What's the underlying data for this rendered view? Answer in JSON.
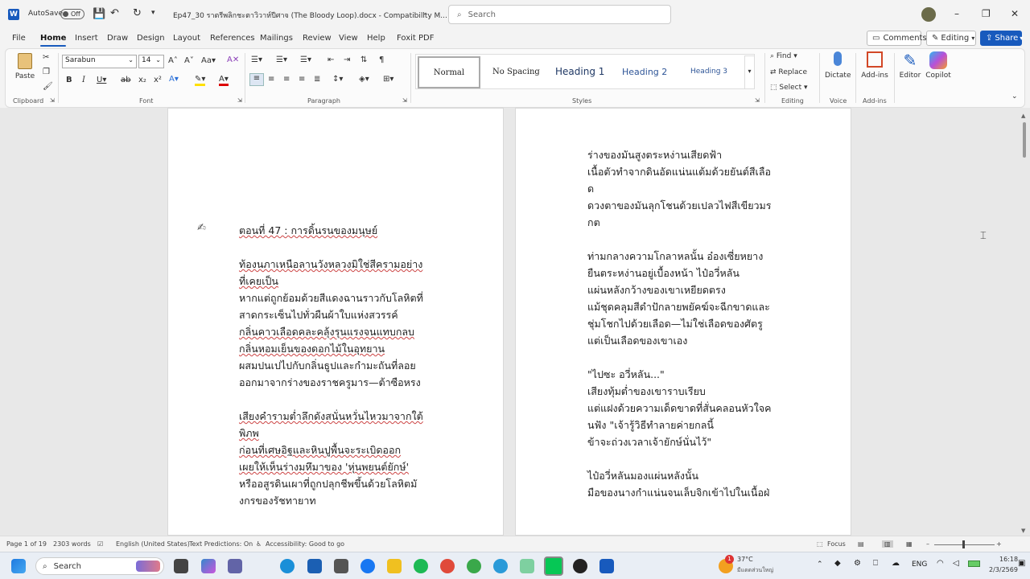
{
  "titlebar": {
    "autosave": "AutoSave",
    "autosave_state": "Off",
    "doc_title": "Ep47_30 ราตรีพลิกชะตาวิวาห์ปีศาจ (The Bloody Loop).docx  -  Compatibility M...",
    "search_placeholder": "Search"
  },
  "menu": {
    "items": [
      "File",
      "Home",
      "Insert",
      "Draw",
      "Design",
      "Layout",
      "References",
      "Mailings",
      "Review",
      "View",
      "Help",
      "Foxit PDF"
    ],
    "comments": "Comments",
    "editing": "Editing",
    "share": "Share"
  },
  "ribbon": {
    "paste": "Paste",
    "clipboard": "Clipboard",
    "font_name": "Sarabun",
    "font_size": "14",
    "font_label": "Font",
    "paragraph_label": "Paragraph",
    "styles_label": "Styles",
    "styles": [
      "Normal",
      "No Spacing",
      "Heading 1",
      "Heading 2",
      "Heading 3"
    ],
    "find": "Find",
    "replace": "Replace",
    "select": "Select",
    "editing_label": "Editing",
    "dictate": "Dictate",
    "voice_label": "Voice",
    "addins": "Add-ins",
    "addins_label": "Add-ins",
    "editor": "Editor",
    "copilot": "Copilot"
  },
  "page_left": {
    "lines": [
      "ตอนที่ 47 : การดิ้นรนของมนุษย์",
      "",
      "ท้องนภาเหนือลานวังหลวงมิใช่สีครามอย่าง",
      "ที่เคยเป็น",
      "หากแต่ถูกย้อมด้วยสีแดงฉานราวกับโลหิตที่",
      "สาดกระเซ็นไปทั่วผืนผ้าใบแห่งสวรรค์",
      "กลิ่นคาวเลือดคละคลุ้งรุนแรงจนแทบกลบ",
      "กลิ่นหอมเย็นของดอกไม้ในอุทยาน",
      "ผสมปนเปไปกับกลิ่นธูปและกำมะถันที่ลอย",
      "ออกมาจากร่างของราชครูมาร—ต้าซือหรง",
      "",
      "เสียงคำรามต่ำลึกดังสนั่นหวั่นไหวมาจากใต้",
      "พิภพ",
      "ก่อนที่เศษอิฐและหินปูพื้นจะระเบิดออก",
      "เผยให้เห็นร่างมหึมาของ 'หุ่นพยนต์ยักษ์'",
      "หรืออสูรดินเผาที่ถูกปลุกชีพขึ้นด้วยโลหิตมั",
      "งกรของรัชทายาท"
    ]
  },
  "page_right": {
    "lines": [
      "ร่างของมันสูงตระหง่านเสียดฟ้า",
      "เนื้อตัวทำจากดินอัดแน่นแต้มด้วยยันต์สีเลือ",
      "ด",
      "ดวงตาของมันลุกโชนด้วยเปลวไฟสีเขียวมร",
      "กต",
      "",
      "ท่ามกลางความโกลาหลนั้น อ๋องเซี่ยหยาง",
      "ยืนตระหง่านอยู่เบื้องหน้า ไป๋อวี่หลัน",
      "แผ่นหลังกว้างของเขาเหยียดตรง",
      "แม้ชุดคลุมสีดำปักลายพยัคฆ์จะฉีกขาดและ",
      "ชุ่มโชกไปด้วยเลือด—ไม่ใช่เลือดของศัตรู",
      "แต่เป็นเลือดของเขาเอง",
      "",
      "\"ไปซะ อวี่หลัน...\"",
      "เสียงทุ้มต่ำของเขาราบเรียบ",
      "แต่แฝงด้วยความเด็ดขาดที่สั่นคลอนหัวใจค",
      "นฟัง \"เจ้ารู้วิธีทำลายค่ายกลนี้",
      "ข้าจะถ่วงเวลาเจ้ายักษ์นั่นไว้\"",
      "",
      "ไป๋อวี่หลันมองแผ่นหลังนั้น",
      "มือของนางกำแน่นจนเล็บจิกเข้าไปในเนื้อฝ่"
    ]
  },
  "status": {
    "page": "Page 1 of 19",
    "words": "2303 words",
    "language": "English (United States)",
    "predictions": "Text Predictions: On",
    "accessibility": "Accessibility: Good to go",
    "focus": "Focus"
  },
  "taskbar": {
    "search": "Search",
    "temp": "37°C",
    "weather": "มีแดดส่วนใหญ่",
    "lang": "ENG",
    "time": "16:18",
    "date": "2/3/2569",
    "badge": "1"
  }
}
